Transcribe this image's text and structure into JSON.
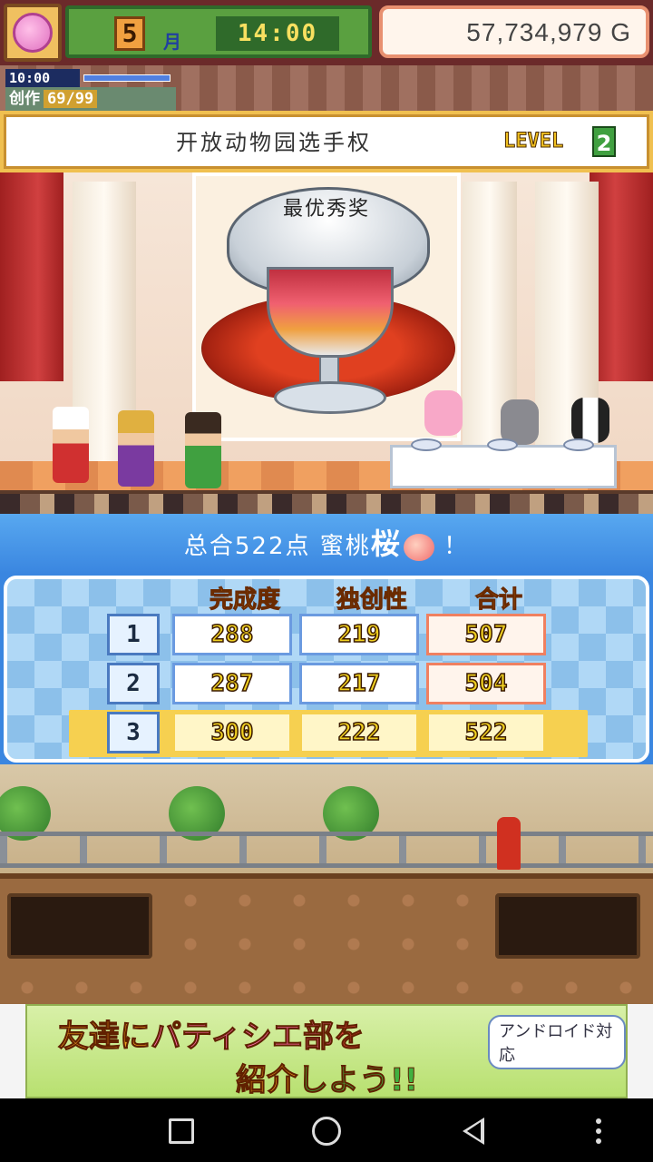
{
  "hud": {
    "month_number": "5",
    "month_label": "月",
    "clock": "14:00",
    "money": "57,734,979 G"
  },
  "subhud": {
    "clock": "10:00",
    "creativity_label": "创作",
    "creativity_value": "69/99"
  },
  "event": {
    "title": "开放动物园选手权",
    "level_label": "LEVEL",
    "level_value": "2"
  },
  "stage": {
    "award_label": "最优秀奖"
  },
  "result": {
    "prefix": "总合522点 蜜桃",
    "name": "桜",
    "suffix": "！"
  },
  "score_table": {
    "columns": [
      "完成度",
      "独创性",
      "合计"
    ],
    "rows": [
      {
        "rank": "1",
        "completion": "288",
        "originality": "219",
        "total": "507"
      },
      {
        "rank": "2",
        "completion": "287",
        "originality": "217",
        "total": "504"
      },
      {
        "rank": "3",
        "completion": "300",
        "originality": "222",
        "total": "522"
      }
    ]
  },
  "ad": {
    "line1_a": "友達に",
    "line1_b": "パティシエ部",
    "line1_c": "を",
    "line2_a": "紹介",
    "line2_b": "しよう!!",
    "badge": "アンドロイド対応"
  },
  "colors": {
    "score_blue": "#3a86e0",
    "highlight_row": "#f6d050",
    "number_yellow": "#f0d020"
  }
}
